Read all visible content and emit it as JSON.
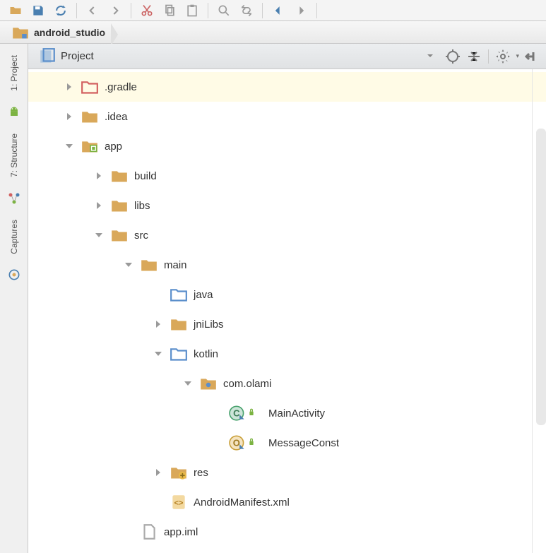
{
  "breadcrumb": {
    "project_name": "android_studio"
  },
  "panel": {
    "view_selector": "Project"
  },
  "left_rail": {
    "tab_project": "1: Project",
    "tab_structure": "7: Structure",
    "tab_captures": "Captures"
  },
  "tree": [
    {
      "id": "gradle",
      "label": ".gradle",
      "depth": 0,
      "twisty": "right",
      "icon": "folder-red-outline",
      "highlight": true
    },
    {
      "id": "idea",
      "label": ".idea",
      "depth": 0,
      "twisty": "right",
      "icon": "folder-filled"
    },
    {
      "id": "app",
      "label": "app",
      "depth": 0,
      "twisty": "down",
      "icon": "folder-module"
    },
    {
      "id": "build",
      "label": "build",
      "depth": 1,
      "twisty": "right",
      "icon": "folder-filled"
    },
    {
      "id": "libs",
      "label": "libs",
      "depth": 1,
      "twisty": "right",
      "icon": "folder-filled"
    },
    {
      "id": "src",
      "label": "src",
      "depth": 1,
      "twisty": "down",
      "icon": "folder-filled"
    },
    {
      "id": "main",
      "label": "main",
      "depth": 2,
      "twisty": "down",
      "icon": "folder-filled"
    },
    {
      "id": "java",
      "label": "java",
      "depth": 3,
      "twisty": "none",
      "icon": "folder-blue-outline"
    },
    {
      "id": "jnilibs",
      "label": "jniLibs",
      "depth": 3,
      "twisty": "right",
      "icon": "folder-filled"
    },
    {
      "id": "kotlin",
      "label": "kotlin",
      "depth": 3,
      "twisty": "down",
      "icon": "folder-blue-outline"
    },
    {
      "id": "comolami",
      "label": "com.olami",
      "depth": 4,
      "twisty": "down",
      "icon": "package"
    },
    {
      "id": "mainactivity",
      "label": "MainActivity",
      "depth": 5,
      "twisty": "none",
      "icon": "class-kotlin"
    },
    {
      "id": "messageconst",
      "label": "MessageConst",
      "depth": 5,
      "twisty": "none",
      "icon": "object-kotlin"
    },
    {
      "id": "res",
      "label": "res",
      "depth": 3,
      "twisty": "right",
      "icon": "folder-res"
    },
    {
      "id": "manifest",
      "label": "AndroidManifest.xml",
      "depth": 3,
      "twisty": "none",
      "icon": "xml-file"
    },
    {
      "id": "appiml",
      "label": "app.iml",
      "depth": 2,
      "twisty": "none",
      "icon": "file"
    }
  ]
}
